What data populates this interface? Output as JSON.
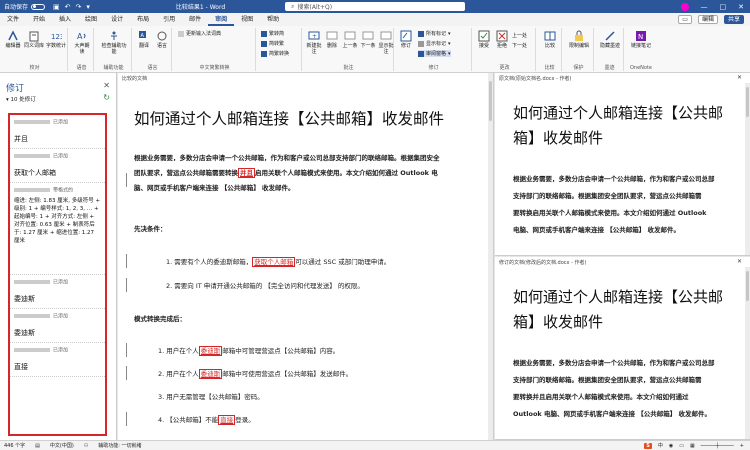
{
  "titlebar": {
    "autosave_label": "自动保存",
    "autosave_state": "关",
    "doc_title": "比较结果1 - Word",
    "search_placeholder": "搜索(Alt+Q)"
  },
  "menubar": {
    "tabs": [
      "文件",
      "开始",
      "插入",
      "绘图",
      "设计",
      "布局",
      "引用",
      "邮件",
      "审阅",
      "视图",
      "帮助"
    ],
    "active_tab": "审阅",
    "edit_label": "编辑",
    "share_label": "共享"
  },
  "ribbon": {
    "proofing": {
      "label": "校对",
      "buttons": [
        "编辑器",
        "同义词库",
        "字数统计"
      ]
    },
    "speech": {
      "label": "语音",
      "buttons": [
        "大声朗读"
      ]
    },
    "accessibility": {
      "label": "辅助功能",
      "buttons": [
        "检查辅助功能"
      ]
    },
    "language": {
      "label": "语言",
      "buttons": [
        "翻译",
        "语言"
      ]
    },
    "chinese_conversion": {
      "label": "中文简繁转换",
      "items": [
        "繁转简",
        "简转繁",
        "简繁转换"
      ]
    },
    "comments": {
      "label": "批注",
      "buttons": [
        "新建批注",
        "删除",
        "上一条",
        "下一条",
        "显示批注"
      ]
    },
    "tracking": {
      "label": "修订",
      "markup": "所有标记",
      "show_markup": "显示标记",
      "pane": "审阅窗格",
      "buttons": [
        "修订"
      ]
    },
    "changes": {
      "label": "更改",
      "buttons": [
        "接受",
        "拒绝"
      ],
      "items": [
        "上一处",
        "下一处"
      ]
    },
    "compare": {
      "label": "比较",
      "buttons": [
        "比较"
      ]
    },
    "protect": {
      "label": "保护",
      "buttons": [
        "限制编辑",
        "隐藏墨迹"
      ]
    },
    "ink": {
      "label": "墨迹",
      "buttons": [
        "隐藏墨迹"
      ]
    },
    "onenote": {
      "label": "OneNote",
      "buttons": [
        "链接笔记"
      ]
    },
    "smalltop": "更新输入法词典"
  },
  "revisions_pane": {
    "title": "修订",
    "count": "10 处修订",
    "items": [
      {
        "kind": "已添加",
        "text": "并且"
      },
      {
        "kind": "已添加",
        "text": "获取个人邮箱"
      },
      {
        "kind": "带格式的",
        "text": "缩进: 左侧: 1.83 厘米, 多级符号 + 级别: 1 + 编号样式: 1, 2, 3, … + 起始编号: 1 + 对齐方式: 左侧 + 对齐位置: 0.63 厘米 + 制表符后于: 1.27 厘米 + 缩进位置: 1.27 厘米"
      },
      {
        "kind": "已添加",
        "text": "委迪斯"
      },
      {
        "kind": "已添加",
        "text": "委迪斯"
      },
      {
        "kind": "已添加",
        "text": "直接"
      }
    ]
  },
  "doc": {
    "label": "比较的文档",
    "title": "如何通过个人邮箱连接【公共邮箱】收发邮件",
    "para1_a": "根据业务需要，多数分店会申请一个公共邮箱，作为和客户或公司总部支持部门的联络邮箱。根据集团安全",
    "para1_b1": "团队要求，营运点公共邮箱需要转换",
    "para1_mark": "并且",
    "para1_b2": "启用关联个人邮箱模式来使用。本文介绍如何通过 Outlook 电",
    "para1_c": "脑、网页或手机客户端来连接 【公共邮箱】 收发邮件。",
    "section1": "先决条件：",
    "item1_a": "1.  需要有个人的委迪斯邮箱，",
    "item1_mark": "获取个人邮箱",
    "item1_b": "可以通过 SSC 或部门助理申请。",
    "item2": "2.  需要向 IT 申请开通公共邮箱的 【完全访问和代理发送】 的权限。",
    "section2": "模式转换完成后：",
    "s1_a": "1.  用户在个人",
    "s1_mark": "委迪斯",
    "s1_b": "邮箱中可管理营运点【公共邮箱】内容。",
    "s2_a": "2.  用户在个人",
    "s2_mark": "委迪斯",
    "s2_b": "邮箱中可使用营运点【公共邮箱】发送邮件。",
    "s3": "3.  用户无需管理【公共邮箱】密码。",
    "s4_a": "4.  【公共邮箱】不能",
    "s4_mark": "直接",
    "s4_b": "登录。"
  },
  "original": {
    "label": "原文档(原始文档名.docx - 作者)",
    "title_l1": "如何通过个人邮箱连接【公共邮",
    "title_l2": "箱】收发邮件",
    "body": [
      "根据业务需要，多数分店会申请一个公共邮箱，作为和客户或公司总部",
      "支持部门的联络邮箱。根据集团安全团队要求，营运点公共邮箱需",
      "要转换启用关联个人邮箱模式来使用。本文介绍如何通过 Outlook",
      "电脑、网页或手机客户端来连接 【公共邮箱】 收发邮件。"
    ]
  },
  "revised": {
    "label": "修订的文档(修改后的文档.docx - 作者)",
    "title_l1": "如何通过个人邮箱连接【公共邮",
    "title_l2": "箱】收发邮件",
    "body": [
      "根据业务需要，多数分店会申请一个公共邮箱，作为和客户或公司总部",
      "支持部门的联络邮箱。根据集团安全团队要求，营运点公共邮箱需",
      "要转换并且启用关联个人邮箱模式来使用。本文介绍如何通过",
      "Outlook 电脑、网页或手机客户端来连接 【公共邮箱】 收发邮件。"
    ]
  },
  "statusbar": {
    "words": "446 个字",
    "lang": "中文(中国)",
    "accessibility": "辅助功能: 一切就绪",
    "sogou": "S"
  }
}
